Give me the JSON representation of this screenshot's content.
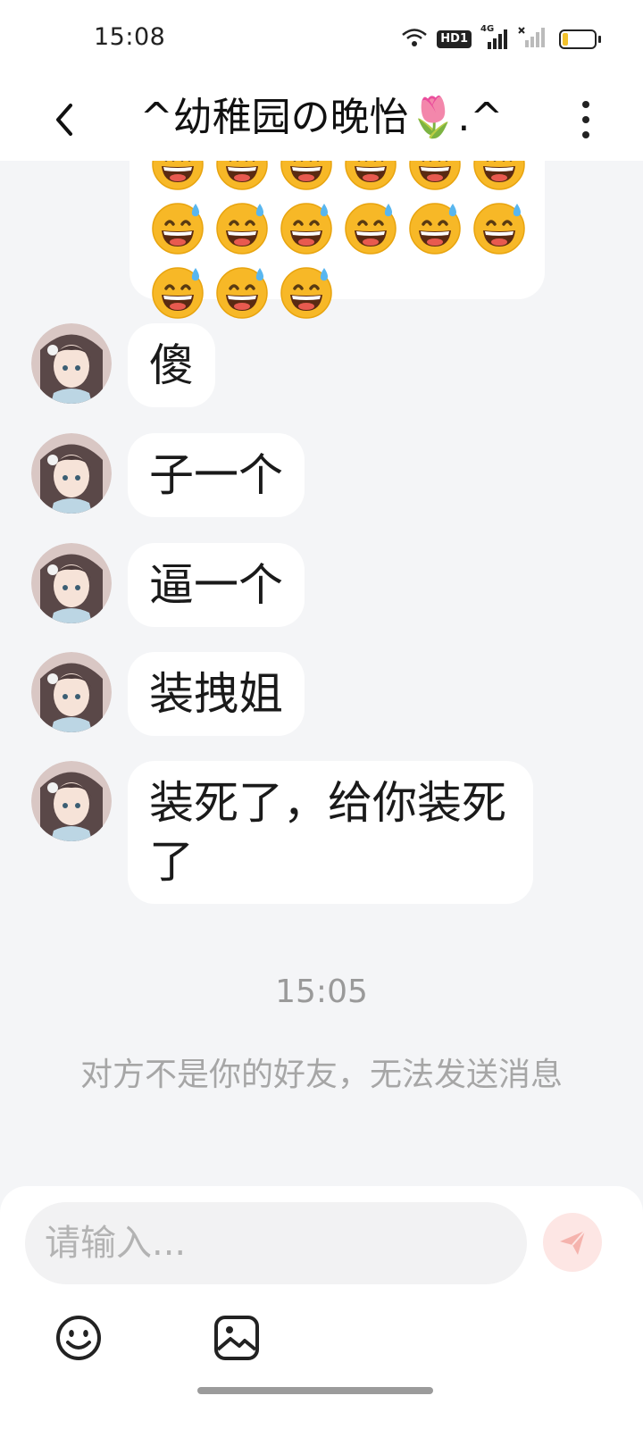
{
  "status_bar": {
    "time": "15:08",
    "hd_label": "HD1",
    "network": "4G",
    "battery_level": 0.12
  },
  "header": {
    "title": "^幼稚园の晚怡🌷.^"
  },
  "messages": [
    {
      "text": "傻"
    },
    {
      "text": "子一个"
    },
    {
      "text": "逼一个"
    },
    {
      "text": "装拽姐"
    },
    {
      "text": "装死了，给你装死了"
    }
  ],
  "emoji_block": {
    "emoji_name": "grinning-face-with-sweat",
    "rows": [
      6,
      6,
      3
    ]
  },
  "time_divider": "15:05",
  "system_note": "对方不是你的好友，无法发送消息",
  "input": {
    "placeholder": "请输入..."
  },
  "colors": {
    "background": "#f4f5f7",
    "bubble": "#ffffff",
    "send_button": "#fde6e4",
    "send_icon": "#f5b3ad"
  }
}
